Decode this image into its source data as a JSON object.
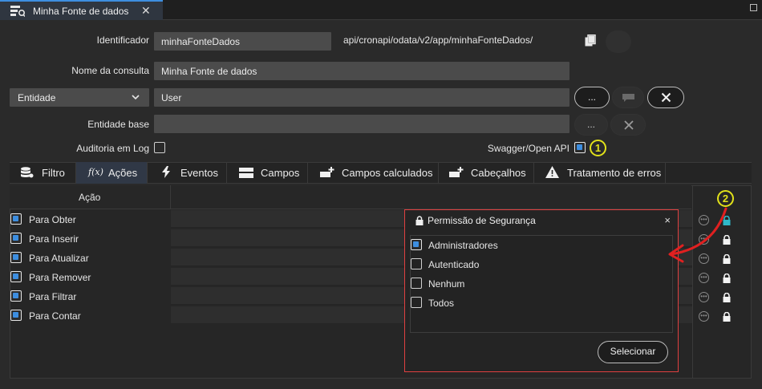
{
  "titlebar": {
    "tab_title": "Minha Fonte de dados",
    "close_glyph": "✕"
  },
  "form": {
    "identificador_label": "Identificador",
    "identificador_value": "minhaFonteDados",
    "api_path": "api/cronapi/odata/v2/app/minhaFonteDados/",
    "nome_consulta_label": "Nome da consulta",
    "nome_consulta_value": "Minha Fonte de dados",
    "entidade_select": "Entidade",
    "entidade_value": "User",
    "entidade_base_label": "Entidade base",
    "entidade_base_value": "",
    "ellipsis_label": "...",
    "auditoria_label": "Auditoria em Log",
    "auditoria_checked": false,
    "swagger_label": "Swagger/Open API",
    "swagger_checked": true,
    "callout1": "1",
    "callout2": "2"
  },
  "tabs": [
    {
      "label": "Filtro",
      "icon": "database-icon"
    },
    {
      "label": "Ações",
      "icon": "function-icon",
      "active": true
    },
    {
      "label": "Eventos",
      "icon": "lightning-icon"
    },
    {
      "label": "Campos",
      "icon": "columns-icon"
    },
    {
      "label": "Campos calculados",
      "icon": "add-field-icon"
    },
    {
      "label": "Cabeçalhos",
      "icon": "add-header-icon"
    },
    {
      "label": "Tratamento de erros",
      "icon": "warning-icon"
    }
  ],
  "grid": {
    "header": "Ação",
    "rows": [
      {
        "label": "Para Obter",
        "checked": true
      },
      {
        "label": "Para Inserir",
        "checked": true
      },
      {
        "label": "Para Atualizar",
        "checked": true
      },
      {
        "label": "Para Remover",
        "checked": true
      },
      {
        "label": "Para Filtrar",
        "checked": true
      },
      {
        "label": "Para Contar",
        "checked": true
      }
    ]
  },
  "modal": {
    "title": "Permissão de Segurança",
    "close_glyph": "×",
    "options": [
      {
        "label": "Administradores",
        "checked": true
      },
      {
        "label": "Autenticado",
        "checked": false
      },
      {
        "label": "Nenhum",
        "checked": false
      },
      {
        "label": "Todos",
        "checked": false
      }
    ],
    "select_button": "Selecionar"
  },
  "colors": {
    "accent": "#3d8ee0",
    "callout": "#e2e21a",
    "annotation": "#e02020",
    "lock_active": "#2fb8c8"
  }
}
